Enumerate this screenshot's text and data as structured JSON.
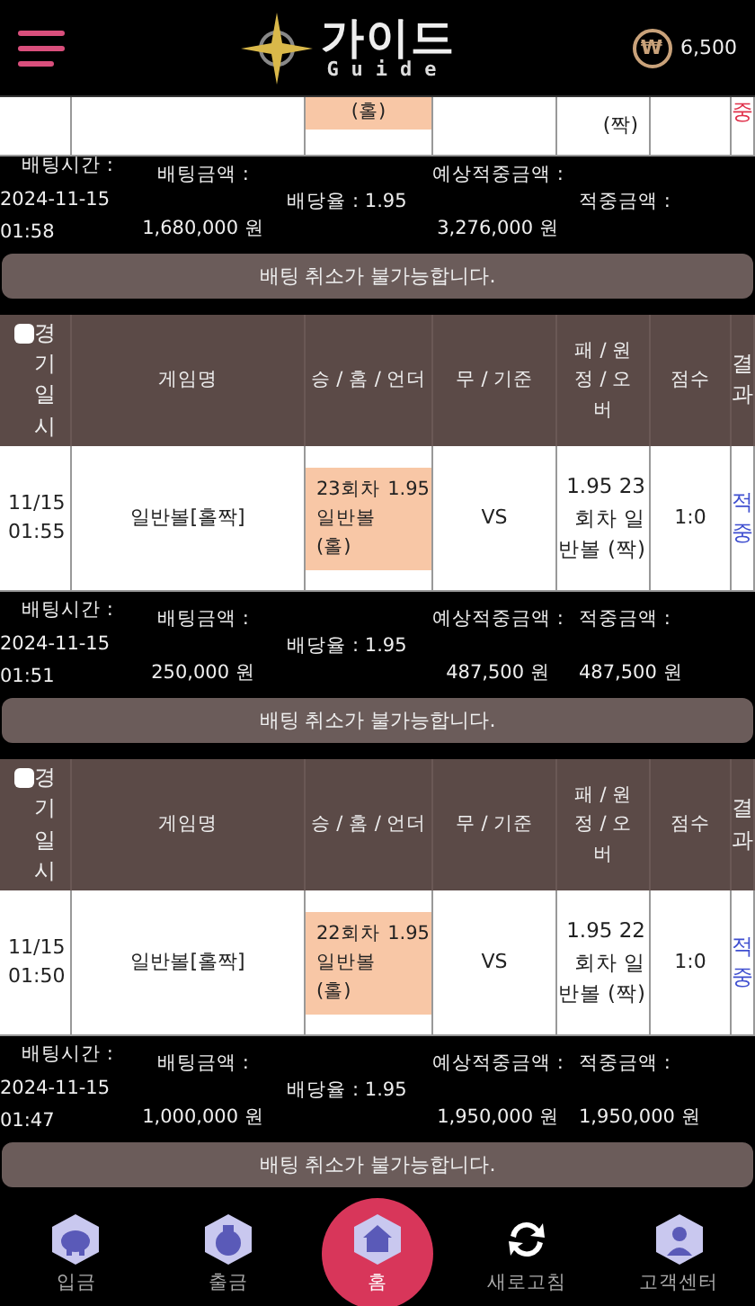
{
  "header": {
    "logo_title": "가이드",
    "logo_subtitle": "Guide",
    "currency_symbol": "₩",
    "balance": "6,500"
  },
  "partial_row": {
    "pick": "(홀)",
    "lose": "(짝)",
    "result": "중",
    "color": "#e0314b"
  },
  "bets": [
    {
      "summary": {
        "time_label": "배팅시간 :",
        "time": "2024-11-15 01:58",
        "amount_label": "배팅금액 :",
        "amount": "1,680,000 원",
        "odds": "배당율 : 1.95",
        "expected_label": "예상적중금액 :",
        "expected": "3,276,000 원",
        "win_label": "적중금액 :"
      },
      "notice": "배팅 취소가 불가능합니다."
    },
    {
      "table": {
        "checked": false,
        "columns": [
          "경기일시",
          "게임명",
          "승 / 홈 / 언더",
          "무 / 기준",
          "패 / 원정 / 오버",
          "점수",
          "결과"
        ],
        "row": {
          "date": "11/15 01:55",
          "game": "일반볼[홀짝]",
          "win_name": "23회차 일반볼 (홀)",
          "win_odds": "1.95",
          "draw": "VS",
          "lose_odds": "1.95",
          "lose_name": "23회차 일반볼 (짝)",
          "score": "1:0",
          "result": "적중",
          "color": "#3f4fd0"
        }
      },
      "summary": {
        "time_label": "배팅시간 :",
        "time": "2024-11-15 01:51",
        "amount_label": "배팅금액 :",
        "amount": "250,000 원",
        "odds": "배당율 : 1.95",
        "expected_label": "예상적중금액 :",
        "expected": "487,500 원",
        "win_label": "적중금액 :",
        "win": "487,500 원"
      },
      "notice": "배팅 취소가 불가능합니다."
    },
    {
      "table": {
        "checked": false,
        "columns": [
          "경기일시",
          "게임명",
          "승 / 홈 / 언더",
          "무 / 기준",
          "패 / 원정 / 오버",
          "점수",
          "결과"
        ],
        "row": {
          "date": "11/15 01:50",
          "game": "일반볼[홀짝]",
          "win_name": "22회차 일반볼 (홀)",
          "win_odds": "1.95",
          "draw": "VS",
          "lose_odds": "1.95",
          "lose_name": "22회차 일반볼 (짝)",
          "score": "1:0",
          "result": "적중",
          "color": "#3f4fd0"
        }
      },
      "summary": {
        "time_label": "배팅시간 :",
        "time": "2024-11-15 01:47",
        "amount_label": "배팅금액 :",
        "amount": "1,000,000 원",
        "odds": "배당율 : 1.95",
        "expected_label": "예상적중금액 :",
        "expected": "1,950,000 원",
        "win_label": "적중금액 :",
        "win": "1,950,000 원"
      },
      "notice": "배팅 취소가 불가능합니다."
    }
  ],
  "nav": [
    {
      "kind": "deposit",
      "label": "입금",
      "selected": false
    },
    {
      "kind": "withdraw",
      "label": "출금",
      "selected": false
    },
    {
      "kind": "home",
      "label": "홈",
      "selected": true
    },
    {
      "kind": "refresh",
      "label": "새로고침",
      "selected": false
    },
    {
      "kind": "support",
      "label": "고객센터",
      "selected": false
    }
  ]
}
